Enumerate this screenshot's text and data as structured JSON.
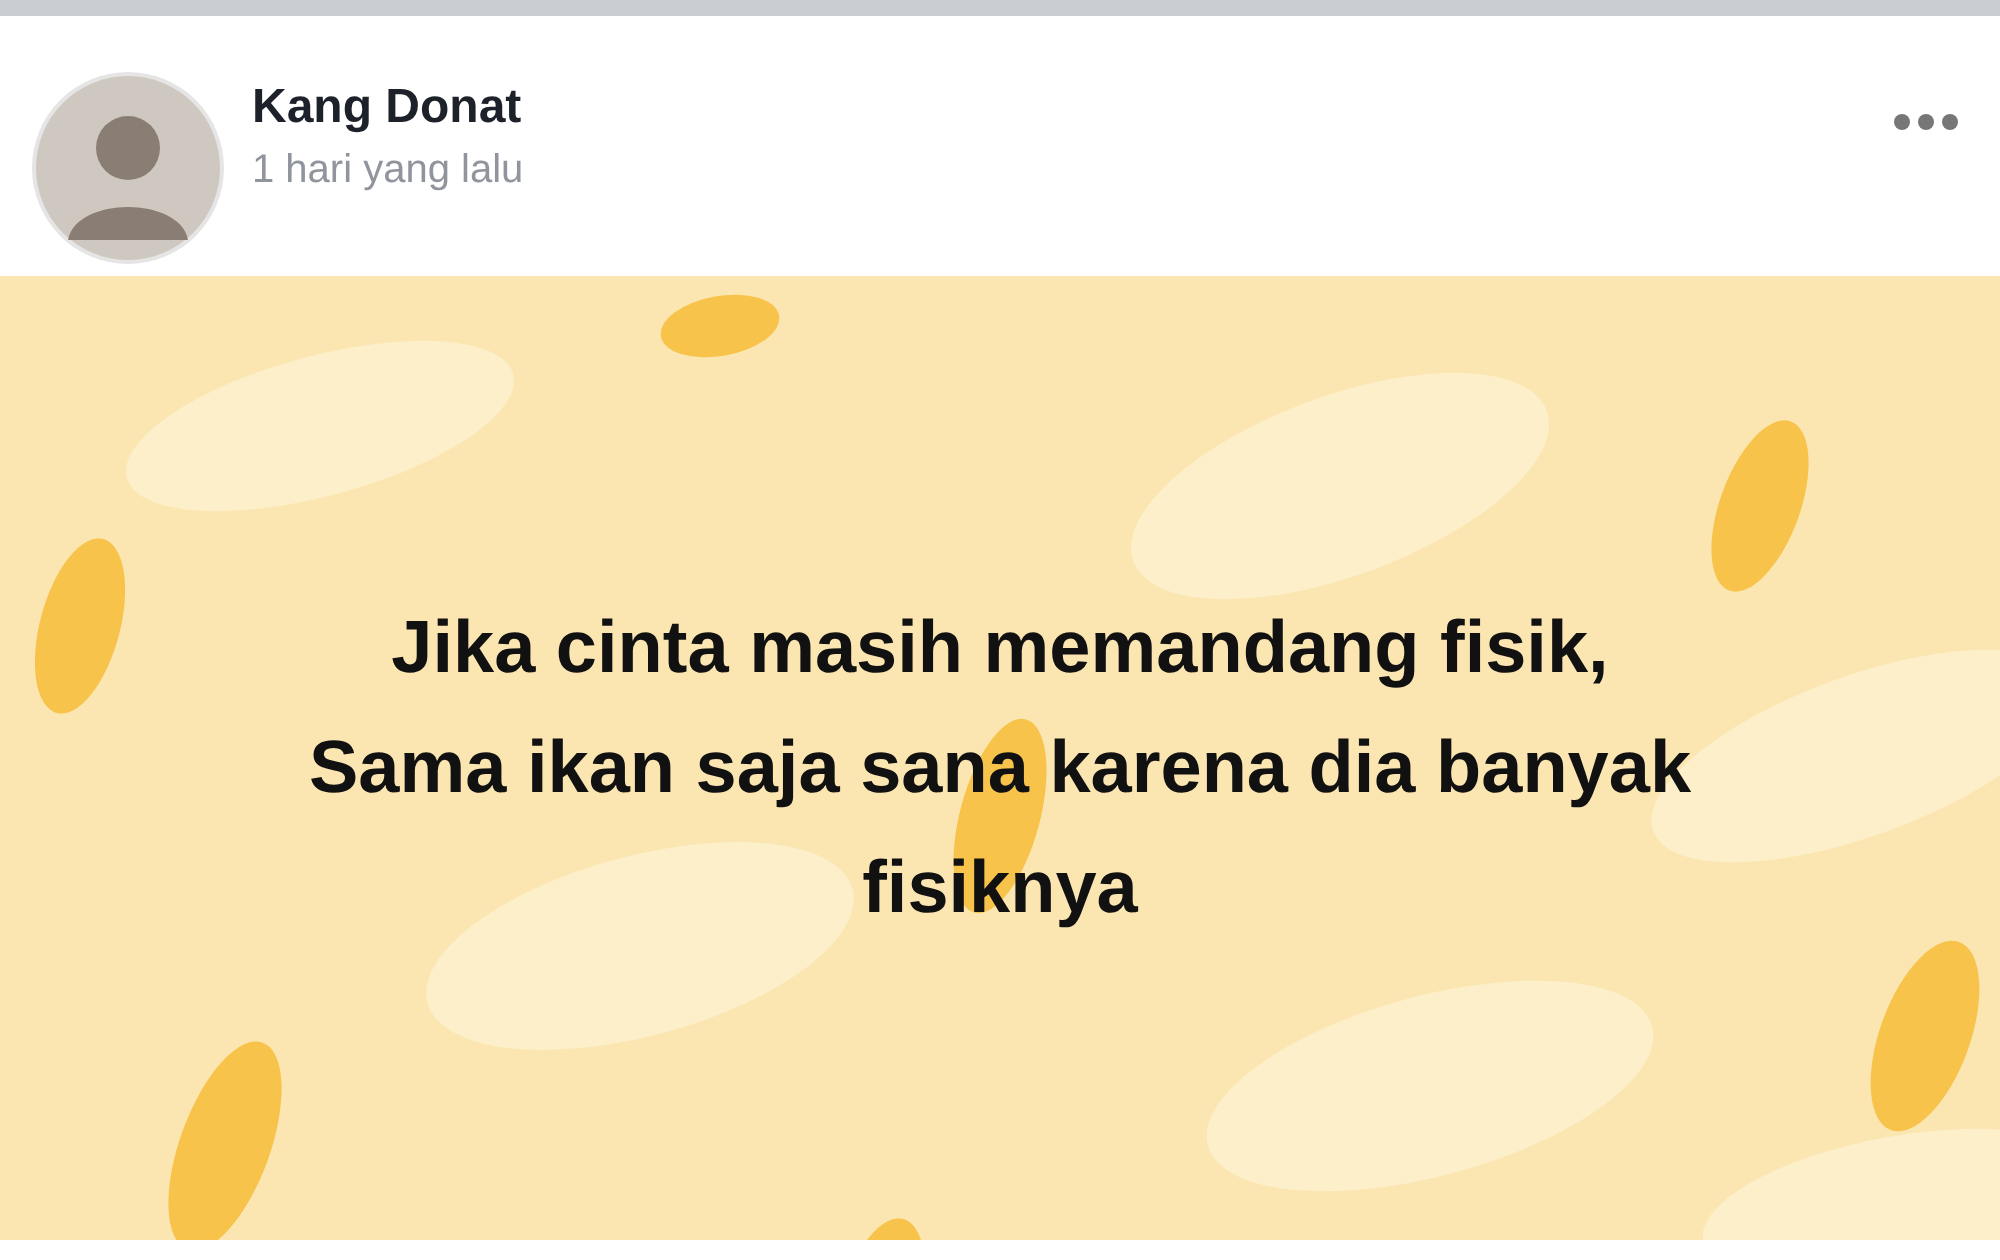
{
  "post": {
    "author": "Kang Donat",
    "time": "1 hari yang lalu",
    "text": "Jika cinta masih memandang fisik,\nSama ikan saja sana karena dia banyak\nfisiknya"
  }
}
